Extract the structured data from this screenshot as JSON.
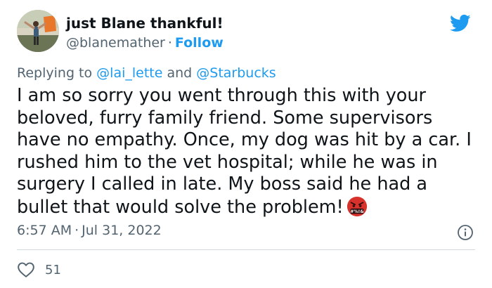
{
  "tweet": {
    "display_name": "just Blane thankful!",
    "handle": "@blanemather",
    "separator": "·",
    "follow_label": "Follow",
    "replying_prefix": "Replying to",
    "mentions": [
      "@lai_lette",
      "@Starbucks"
    ],
    "conjunction": "and",
    "text": "I am so sorry you went through this with your beloved, furry family friend. Some supervisors have no empathy. Once, my dog was hit by a car. I rushed him to the vet hospital; while he was in surgery I called in late. My boss said he had a bullet that would solve the problem!",
    "emoji": "face-with-symbols-on-mouth",
    "emoji_symbols": "#%!&",
    "time": "6:57 AM",
    "date": "Jul 31, 2022",
    "like_count": "51"
  },
  "colors": {
    "accent": "#1d9bf0",
    "secondary_text": "#536471",
    "primary_text": "#0f1419",
    "divider": "#cfd9de",
    "emoji_red": "#d8322c"
  },
  "icons": [
    "avatar-photo",
    "twitter-bird-icon",
    "info-icon",
    "heart-icon"
  ]
}
